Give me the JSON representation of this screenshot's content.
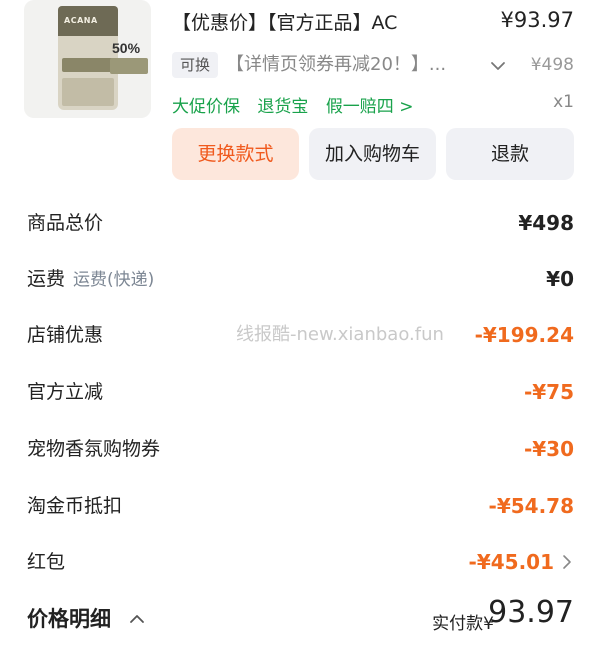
{
  "product": {
    "thumbnail_brand": "ACANA",
    "thumbnail_badge": "50%",
    "title": "【优惠价】【官方正品】AC",
    "price": "¥93.97",
    "swap_tag": "可换",
    "coupon_text": "【详情页领券再减20！】...",
    "original_price": "¥498",
    "guarantees": [
      "大促价保",
      "退货宝",
      "假一赔四 >"
    ],
    "quantity": "x1",
    "accent_green": "#19a24b"
  },
  "actions": {
    "swap_style": "更换款式",
    "add_to_cart": "加入购物车",
    "refund": "退款"
  },
  "price_rows": [
    {
      "label": "商品总价",
      "sublabel": "",
      "value": "¥498",
      "color": "black"
    },
    {
      "label": "运费",
      "sublabel": "运费(快递)",
      "value": "¥0",
      "color": "black"
    },
    {
      "label": "店铺优惠",
      "sublabel": "",
      "value": "-¥199.24",
      "color": "orange"
    },
    {
      "label": "官方立减",
      "sublabel": "",
      "value": "-¥75",
      "color": "orange"
    },
    {
      "label": "宠物香氛购物券",
      "sublabel": "",
      "value": "-¥30",
      "color": "orange"
    },
    {
      "label": "淘金币抵扣",
      "sublabel": "",
      "value": "-¥54.78",
      "color": "orange"
    },
    {
      "label": "红包",
      "sublabel": "",
      "value": "-¥45.01",
      "color": "orange"
    }
  ],
  "watermark": "线报酷-new.xianbao.fun",
  "summary": {
    "detail_label": "价格明细",
    "paid_label": "实付款¥",
    "paid_value": "93.97"
  },
  "colors": {
    "orange": "#f06a1e",
    "swap_button_bg": "#fde7dc",
    "neutral_button_bg": "#f0f1f5"
  }
}
